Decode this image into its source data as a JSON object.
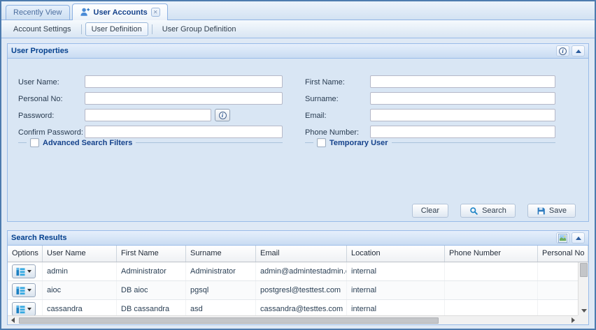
{
  "window": {
    "tabs": [
      {
        "label": "Recently View",
        "active": false
      },
      {
        "label": "User Accounts",
        "active": true,
        "closable": true
      }
    ]
  },
  "toolbar": {
    "items": [
      "Account Settings",
      "User Definition",
      "User Group Definition"
    ],
    "selected": "User Definition"
  },
  "user_properties": {
    "title": "User Properties",
    "fields_left": [
      {
        "label": "User Name:",
        "value": ""
      },
      {
        "label": "Personal No:",
        "value": ""
      },
      {
        "label": "Password:",
        "value": "",
        "has_info_button": true
      },
      {
        "label": "Confirm Password:",
        "value": ""
      }
    ],
    "fields_right": [
      {
        "label": "First Name:",
        "value": ""
      },
      {
        "label": "Surname:",
        "value": ""
      },
      {
        "label": "Email:",
        "value": ""
      },
      {
        "label": "Phone Number:",
        "value": ""
      }
    ],
    "advanced_search_filters": {
      "label": "Advanced Search Filters",
      "checked": false
    },
    "temporary_user": {
      "label": "Temporary User",
      "checked": false
    },
    "buttons": {
      "clear": "Clear",
      "search": "Search",
      "save": "Save"
    }
  },
  "search_results": {
    "title": "Search Results",
    "columns": [
      "Options",
      "User Name",
      "First Name",
      "Surname",
      "Email",
      "Location",
      "Phone Number",
      "Personal No"
    ],
    "rows": [
      {
        "user_name": "admin",
        "first_name": "Administrator",
        "surname": "Administrator",
        "email": "admin@admintestadmin.c...",
        "location": "internal",
        "phone_number": "",
        "personal_no": ""
      },
      {
        "user_name": "aioc",
        "first_name": "DB aioc",
        "surname": "pgsql",
        "email": "postgresl@testtest.com",
        "location": "internal",
        "phone_number": "",
        "personal_no": ""
      },
      {
        "user_name": "cassandra",
        "first_name": "DB cassandra",
        "surname": "asd",
        "email": "cassandra@testtes.com",
        "location": "internal",
        "phone_number": "",
        "personal_no": ""
      }
    ]
  },
  "colors": {
    "panel_border": "#99bbe8",
    "panel_title": "#04408d",
    "accent": "#15428b",
    "options_icon_blue": "#2ba7e0"
  }
}
